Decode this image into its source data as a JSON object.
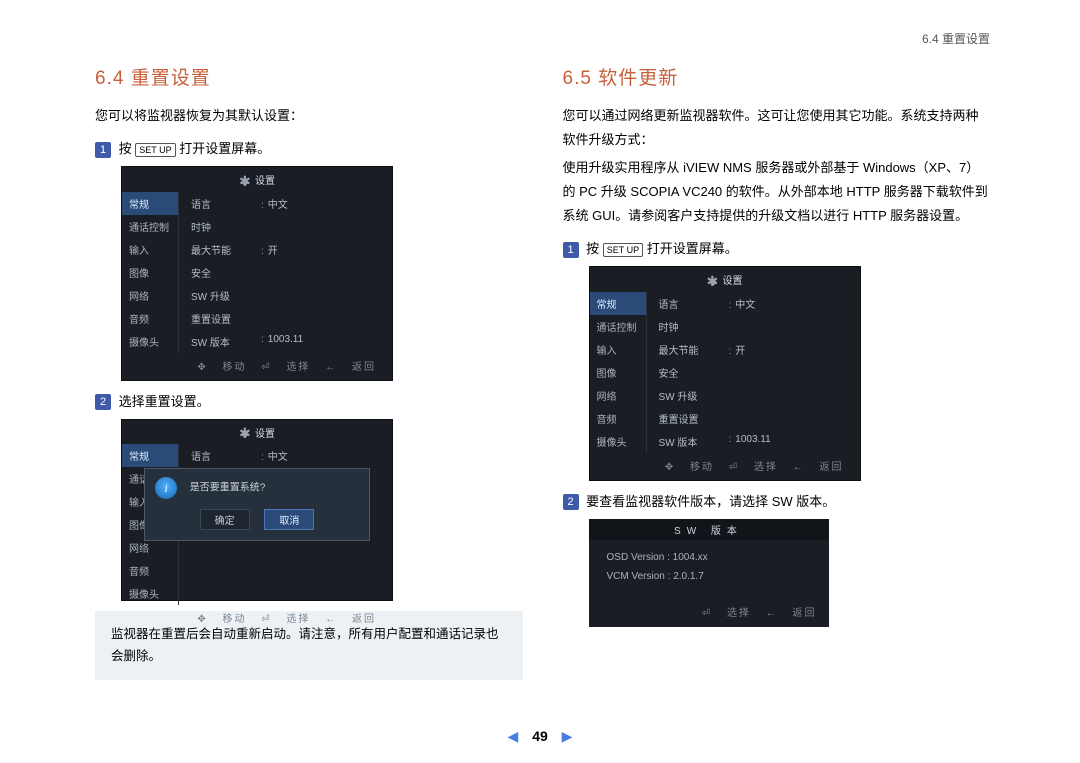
{
  "header": "6.4 重置设置",
  "page_num": "49",
  "left": {
    "heading": "6.4  重置设置",
    "intro": "您可以将监视器恢复为其默认设置：",
    "step1_prefix": "按",
    "step1_key": "SET UP",
    "step1_suffix": "打开设置屏幕。",
    "step2": "选择重置设置。",
    "note": "监视器在重置后会自动重新启动。请注意，所有用户配置和通话记录也会删除。"
  },
  "right": {
    "heading": "6.5  软件更新",
    "p1": "您可以通过网络更新监视器软件。这可让您使用其它功能。系统支持两种软件升级方式：",
    "p2": "使用升级实用程序从 iVIEW NMS 服务器或外部基于 Windows（XP、7）的 PC 升级 SCOPIA VC240 的软件。从外部本地 HTTP 服务器下载软件到系统 GUI。请参阅客户支持提供的升级文档以进行 HTTP 服务器设置。",
    "step1_prefix": "按",
    "step1_key": "SET UP",
    "step1_suffix": "打开设置屏幕。",
    "step2": "要查看监视器软件版本，请选择 SW 版本。"
  },
  "osd": {
    "title": "设置",
    "side": [
      "常规",
      "通话控制",
      "输入",
      "图像",
      "网络",
      "音频",
      "摄像头"
    ],
    "rows": [
      {
        "lab": "语言",
        "val": "中文",
        "colon": true
      },
      {
        "lab": "时钟",
        "val": ""
      },
      {
        "lab": "最大节能",
        "val": "开",
        "colon": true
      },
      {
        "lab": "安全",
        "val": ""
      },
      {
        "lab": "SW 升级",
        "val": ""
      },
      {
        "lab": "重置设置",
        "val": ""
      },
      {
        "lab": "SW 版本",
        "val": "1003.11",
        "colon": true
      }
    ],
    "foot": {
      "move": "移动",
      "sel": "选择",
      "back": "返回"
    }
  },
  "dlg": {
    "text": "是否要重置系统?",
    "ok": "确定",
    "cancel": "取消"
  },
  "sw": {
    "title": "SW 版本",
    "l1": "OSD Version : 1004.xx",
    "l2": "VCM Version : 2.0.1.7",
    "sel": "选择",
    "back": "返回"
  }
}
